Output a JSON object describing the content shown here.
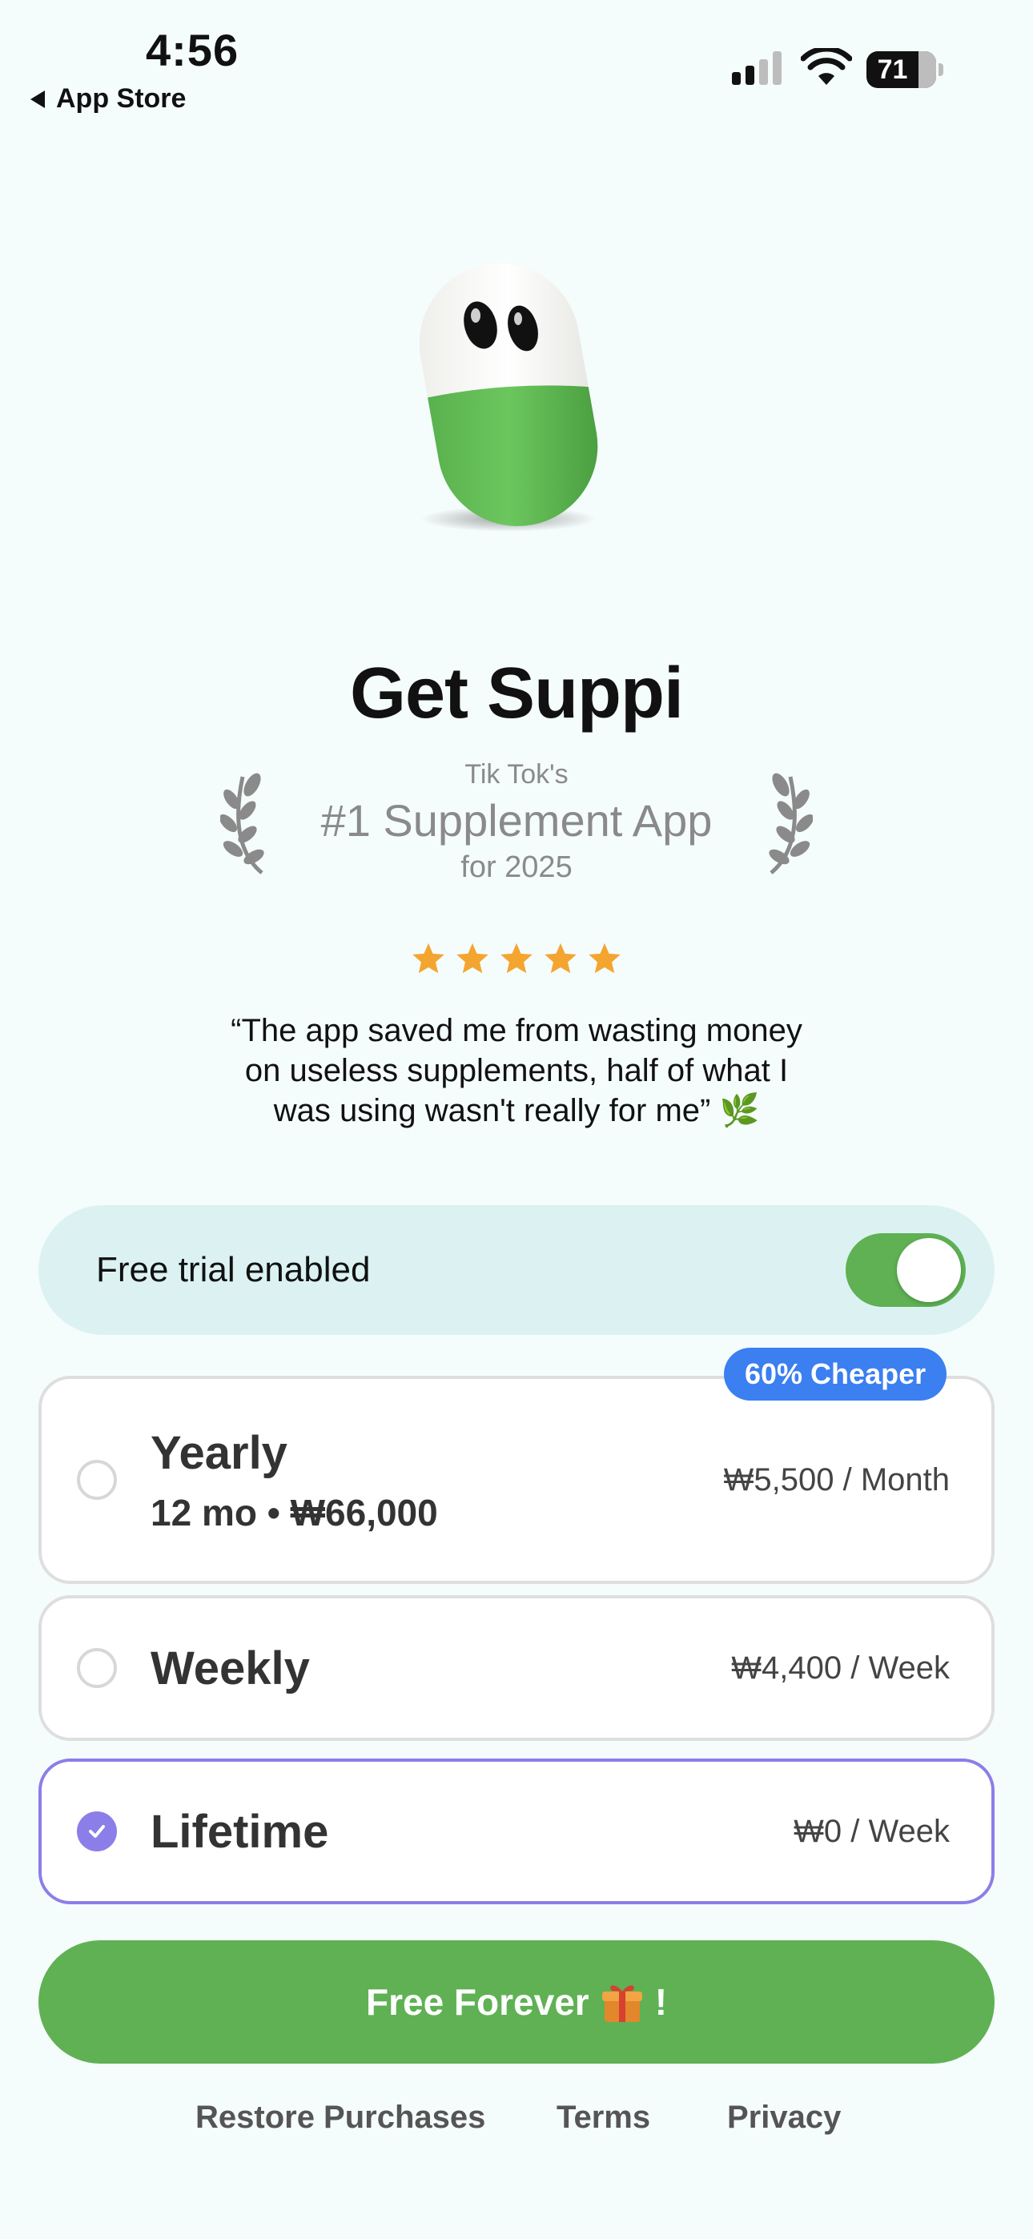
{
  "status_bar": {
    "time": "4:56",
    "back_label": "App Store",
    "battery": "71"
  },
  "hero": {
    "title": "Get Suppi",
    "award_top": "Tik Tok's",
    "award_main": "#1 Supplement App",
    "award_bottom": "for 2025",
    "rating_stars": 5,
    "quote": "“The app saved me from wasting money on useless supplements, half of what I was using wasn't really for me” 🌿"
  },
  "trial": {
    "label": "Free trial enabled",
    "enabled": true
  },
  "plans": [
    {
      "name": "Yearly",
      "sub": "12 mo • ₩66,000",
      "price": "₩5,500 / Month",
      "badge": "60% Cheaper",
      "selected": false
    },
    {
      "name": "Weekly",
      "price": "₩4,400 / Week",
      "selected": false
    },
    {
      "name": "Lifetime",
      "price": "₩0 / Week",
      "selected": true
    }
  ],
  "cta": {
    "label": "Free Forever",
    "suffix": "!"
  },
  "footer": {
    "restore": "Restore Purchases",
    "terms": "Terms",
    "privacy": "Privacy"
  },
  "colors": {
    "accent_green": "#5fb153",
    "selected_purple": "#8b7ee8",
    "badge_blue": "#3b7ff0",
    "star_orange": "#f4a530",
    "trial_bg": "#dcf2f2"
  },
  "icons": [
    "back-arrow-icon",
    "cellular-signal-icon",
    "wifi-icon",
    "battery-icon",
    "laurel-left-icon",
    "laurel-right-icon",
    "star-icon",
    "leaf-icon",
    "checkmark-icon",
    "gift-icon"
  ]
}
